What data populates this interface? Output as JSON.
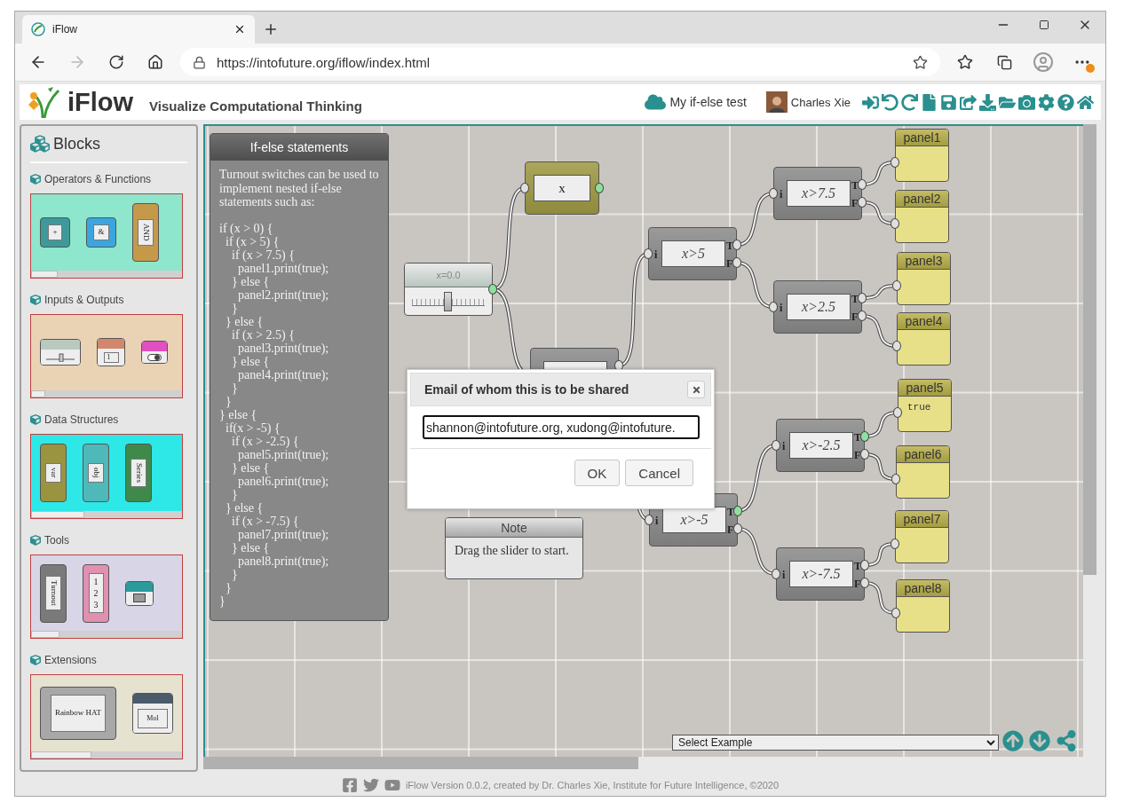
{
  "browser": {
    "tab_title": "iFlow",
    "url": "https://intofuture.org/iflow/index.html"
  },
  "header": {
    "app_name": "iFlow",
    "tagline": "Visualize Computational Thinking",
    "project": "My if-else test",
    "user": "Charles Xie"
  },
  "sidebar": {
    "title": "Blocks",
    "sections": [
      {
        "title": "Operators & Functions",
        "color": "#8ee6cc",
        "blocks": [
          {
            "kind": "square",
            "label": "+",
            "color": "#3e9a9a"
          },
          {
            "kind": "square",
            "label": "&",
            "color": "#3aa6e0"
          },
          {
            "kind": "vertical",
            "label": "AND",
            "color": "#c49a4a"
          }
        ]
      },
      {
        "title": "Inputs & Outputs",
        "color": "#ead3b5",
        "blocks": [
          {
            "kind": "slider",
            "color": "#b9c9c0"
          },
          {
            "kind": "dropdown",
            "label": "1",
            "color": "#d2876a"
          },
          {
            "kind": "toggle",
            "color": "#e050c0"
          }
        ]
      },
      {
        "title": "Data Structures",
        "color": "#2ee8e8",
        "blocks": [
          {
            "kind": "vertical",
            "label": "var",
            "color": "#9a9440"
          },
          {
            "kind": "vertical",
            "label": "obj",
            "color": "#4fb8b8"
          },
          {
            "kind": "vertical",
            "label": "Series",
            "color": "#3f8a4a"
          }
        ]
      },
      {
        "title": "Tools",
        "color": "#d8d6e6",
        "blocks": [
          {
            "kind": "vertical",
            "label": "Turnout",
            "color": "#7a7a7a"
          },
          {
            "kind": "numbers",
            "labels": [
              "1",
              "2",
              "3"
            ],
            "color": "#e090b0"
          },
          {
            "kind": "screen",
            "color": "#2a9a9a"
          }
        ]
      },
      {
        "title": "Extensions",
        "color": "#e6e2d0",
        "blocks": [
          {
            "kind": "wide",
            "label": "Rainbow HAT",
            "color": "#a8a8a8"
          },
          {
            "kind": "screen",
            "label": "Mol",
            "color": "#4a5a6a"
          }
        ]
      }
    ]
  },
  "canvas": {
    "code_panel": {
      "title": "If-else statements",
      "intro": "Turnout switches can be used to implement nested if-else statements such as:",
      "code": "if (x > 0) {\n  if (x > 5) {\n    if (x > 7.5) {\n      panel1.print(true);\n    } else {\n      panel2.print(true);\n    }\n  } else {\n    if (x > 2.5) {\n      panel3.print(true);\n    } else {\n      panel4.print(true);\n    }\n  }\n} else {\n  if(x > -5) {\n    if (x > -2.5) {\n      panel5.print(true);\n    } else {\n      panel6.print(true);\n    }\n  } else {\n    if (x > -7.5) {\n      panel7.print(true);\n    } else {\n      panel8.print(true);\n    }\n  }\n}"
    },
    "slider": {
      "label": "x=0.0",
      "level": 0.5,
      "active": true
    },
    "variable": {
      "label": "x",
      "active": true
    },
    "turnouts": [
      {
        "fired": false
      },
      {
        "expr": "x>5",
        "fired": false,
        "ports": [
          "i",
          "T",
          "F"
        ]
      },
      {
        "expr": "x>7.5",
        "fired": false,
        "ports": [
          "i",
          "T",
          "F"
        ]
      },
      {
        "expr": "x>2.5",
        "fired": false,
        "ports": [
          "i",
          "T",
          "F"
        ]
      },
      {
        "expr": "x>-5",
        "fired": true,
        "ports": [
          "i",
          "T",
          "F"
        ]
      },
      {
        "expr": "x>-2.5",
        "fired": true,
        "ports": [
          "i",
          "T",
          "F"
        ]
      },
      {
        "expr": "x>-7.5",
        "fired": false,
        "ports": [
          "i",
          "T",
          "F"
        ]
      }
    ],
    "panels": [
      {
        "title": "panel1"
      },
      {
        "title": "panel2"
      },
      {
        "title": "panel3"
      },
      {
        "title": "panel4"
      },
      {
        "title": "panel5",
        "value": "true"
      },
      {
        "title": "panel6"
      },
      {
        "title": "panel7"
      },
      {
        "title": "panel8"
      }
    ],
    "note": {
      "title": "Note",
      "text": "Drag the slider to start."
    },
    "example_select": {
      "value": "Select Example"
    }
  },
  "dialog": {
    "title": "Email of whom this is to be shared",
    "value": "shannon@intofuture.org, xudong@intofuture.",
    "buttons": [
      "OK",
      "Cancel"
    ]
  },
  "footer": {
    "text": "iFlow Version 0.0.2, created by Dr. Charles Xie, Institute for Future Intelligence, ©2020"
  }
}
